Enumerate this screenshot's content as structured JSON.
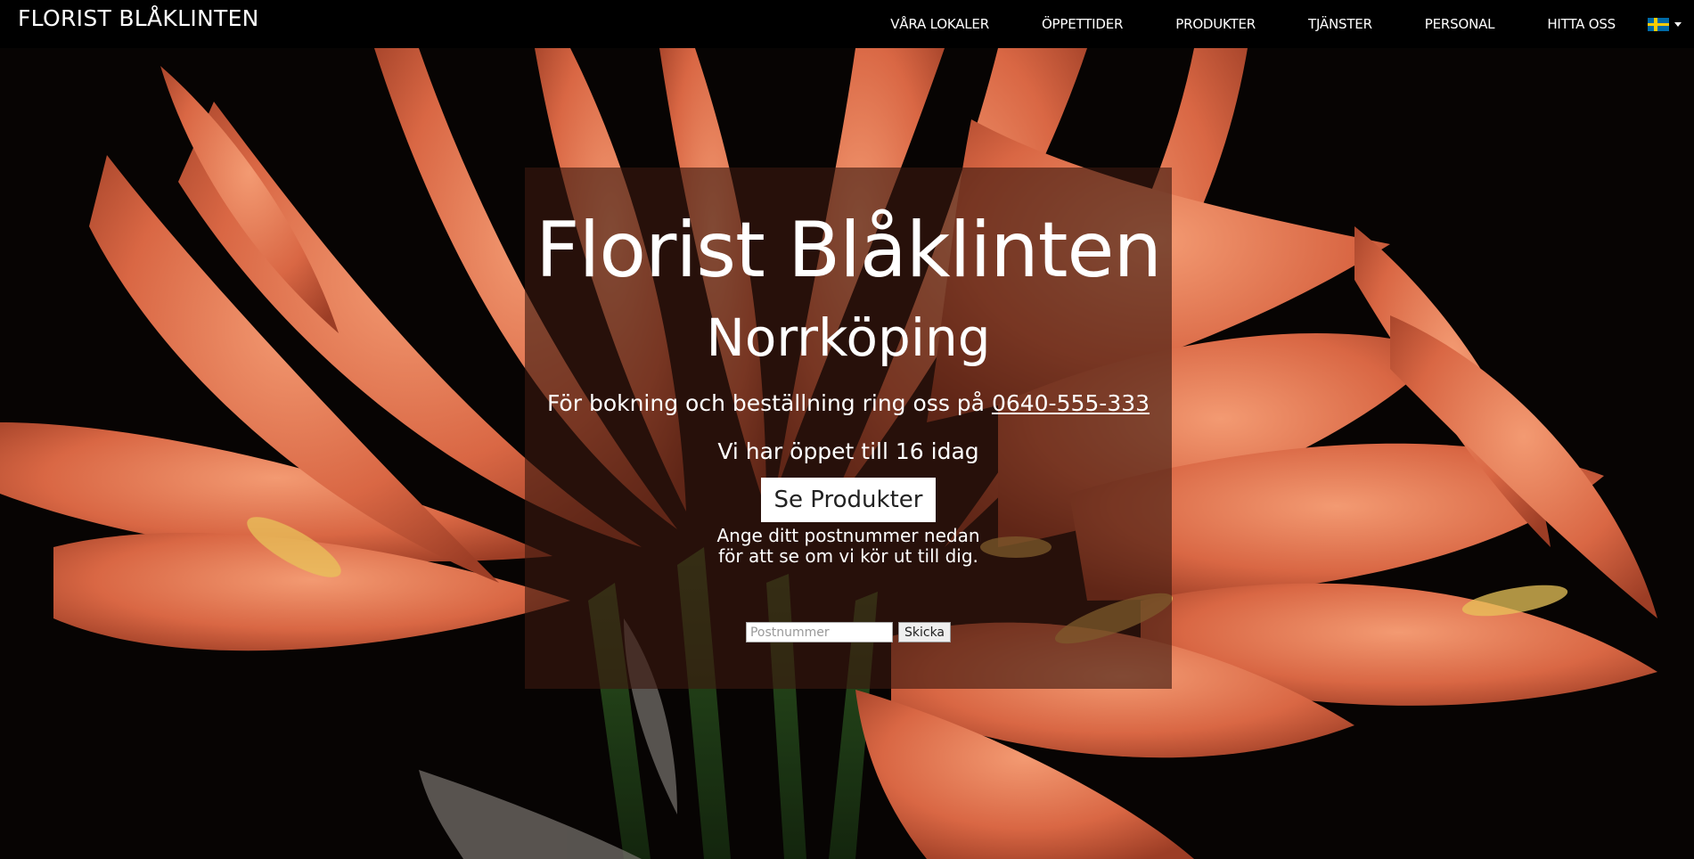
{
  "navbar": {
    "brand": "FLORIST BLÅKLINTEN",
    "links": [
      {
        "label": "VÅRA LOKALER"
      },
      {
        "label": "ÖPPETTIDER"
      },
      {
        "label": "PRODUKTER"
      },
      {
        "label": "TJÄNSTER"
      },
      {
        "label": "PERSONAL"
      },
      {
        "label": "HITTA OSS"
      }
    ],
    "language_icon": "sweden-flag-icon"
  },
  "hero": {
    "title": "Florist Blåklinten",
    "subtitle": "Norrköping",
    "booking_text": "För bokning och beställning ring oss på",
    "phone": "0640-555-333",
    "hours_text": "Vi har öppet till 16 idag",
    "cta_label": "Se Produkter",
    "postal_line1": "Ange ditt postnummer nedan",
    "postal_line2": "för att se om vi kör ut till dig.",
    "postal_placeholder": "Postnummer",
    "submit_label": "Skicka"
  },
  "colors": {
    "navbar_bg": "#000000",
    "petal": "#e0714f",
    "panel_overlay": "rgba(60,25,15,0.62)"
  }
}
